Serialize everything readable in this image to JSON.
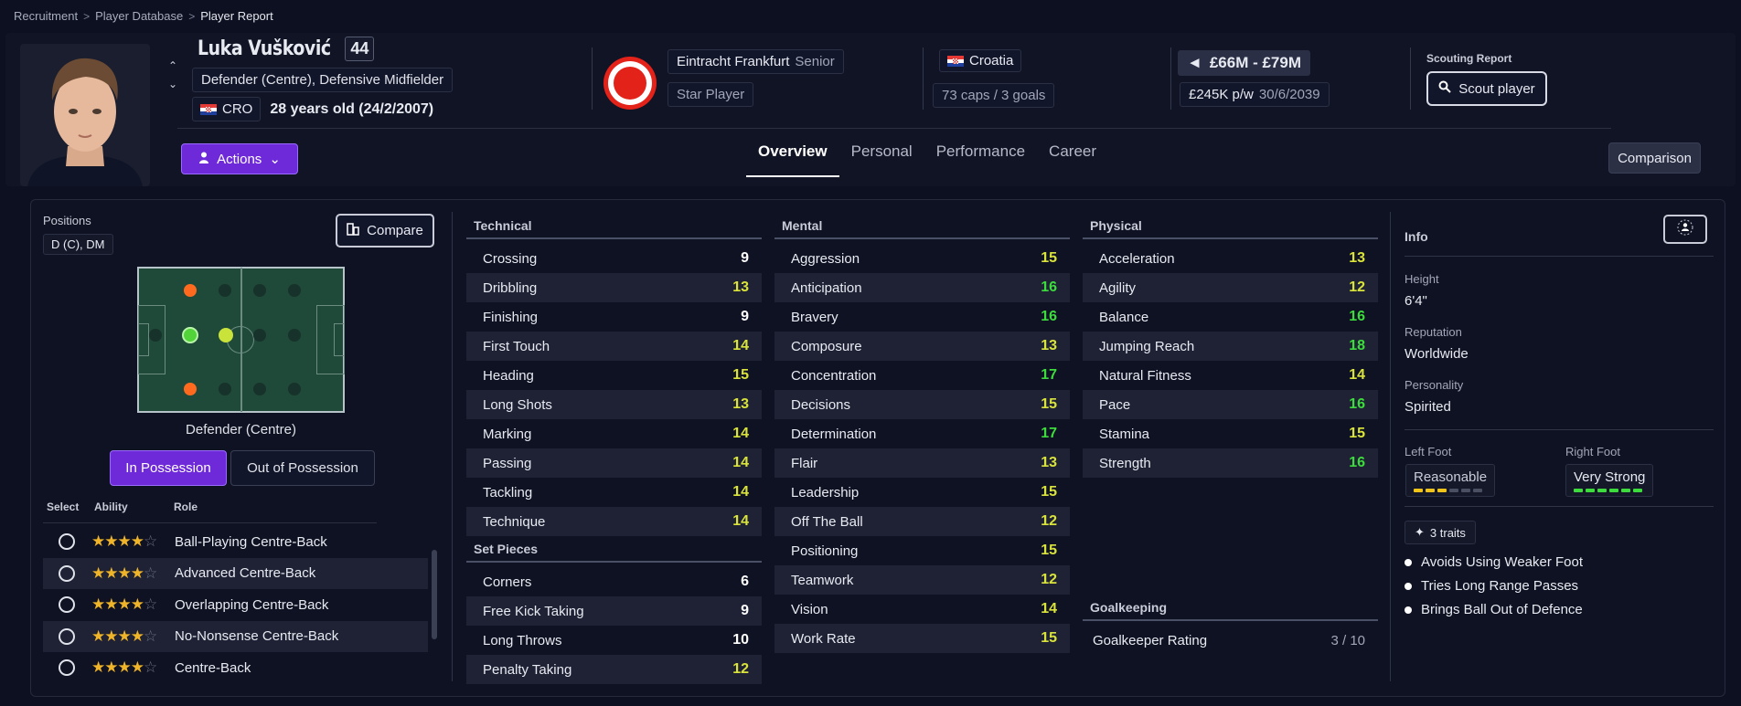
{
  "breadcrumb": [
    "Recruitment",
    "Player Database",
    "Player Report"
  ],
  "player": {
    "name": "Luka Vušković",
    "ca": "44",
    "positions": "Defender (Centre), Defensive Midfielder",
    "nationality_code": "CRO",
    "age": "28 years old (24/2/2007)"
  },
  "club": {
    "name": "Eintracht Frankfurt",
    "squad": "Senior",
    "status": "Star Player"
  },
  "international": {
    "country": "Croatia",
    "caps": "73 caps / 3 goals"
  },
  "value": {
    "range": "£66M - £79M",
    "wage": "£245K p/w",
    "expiry": "30/6/2039"
  },
  "scouting": {
    "label": "Scouting Report",
    "button": "Scout player"
  },
  "actions_label": "Actions",
  "tabs": [
    "Overview",
    "Personal",
    "Performance",
    "Career"
  ],
  "active_tab": "Overview",
  "comparison_label": "Comparison",
  "left": {
    "positions_label": "Positions",
    "positions_value": "D (C), DM",
    "compare_label": "Compare",
    "pitch_label": "Defender (Centre)",
    "possession": [
      "In Possession",
      "Out of Possession"
    ],
    "role_headers": [
      "Select",
      "Ability",
      "Role"
    ],
    "roles": [
      {
        "name": "Ball-Playing Centre-Back",
        "stars": 4
      },
      {
        "name": "Advanced Centre-Back",
        "stars": 4
      },
      {
        "name": "Overlapping Centre-Back",
        "stars": 4
      },
      {
        "name": "No-Nonsense Centre-Back",
        "stars": 4
      },
      {
        "name": "Centre-Back",
        "stars": 4
      }
    ]
  },
  "technical": {
    "title": "Technical",
    "rows": [
      [
        "Crossing",
        "9"
      ],
      [
        "Dribbling",
        "13"
      ],
      [
        "Finishing",
        "9"
      ],
      [
        "First Touch",
        "14"
      ],
      [
        "Heading",
        "15"
      ],
      [
        "Long Shots",
        "13"
      ],
      [
        "Marking",
        "14"
      ],
      [
        "Passing",
        "14"
      ],
      [
        "Tackling",
        "14"
      ],
      [
        "Technique",
        "14"
      ]
    ]
  },
  "set_pieces": {
    "title": "Set Pieces",
    "rows": [
      [
        "Corners",
        "6"
      ],
      [
        "Free Kick Taking",
        "9"
      ],
      [
        "Long Throws",
        "10"
      ],
      [
        "Penalty Taking",
        "12"
      ]
    ]
  },
  "mental": {
    "title": "Mental",
    "rows": [
      [
        "Aggression",
        "15"
      ],
      [
        "Anticipation",
        "16"
      ],
      [
        "Bravery",
        "16"
      ],
      [
        "Composure",
        "13"
      ],
      [
        "Concentration",
        "17"
      ],
      [
        "Decisions",
        "15"
      ],
      [
        "Determination",
        "17"
      ],
      [
        "Flair",
        "13"
      ],
      [
        "Leadership",
        "15"
      ],
      [
        "Off The Ball",
        "12"
      ],
      [
        "Positioning",
        "15"
      ],
      [
        "Teamwork",
        "12"
      ],
      [
        "Vision",
        "14"
      ],
      [
        "Work Rate",
        "15"
      ]
    ]
  },
  "physical": {
    "title": "Physical",
    "rows": [
      [
        "Acceleration",
        "13"
      ],
      [
        "Agility",
        "12"
      ],
      [
        "Balance",
        "16"
      ],
      [
        "Jumping Reach",
        "18"
      ],
      [
        "Natural Fitness",
        "14"
      ],
      [
        "Pace",
        "16"
      ],
      [
        "Stamina",
        "15"
      ],
      [
        "Strength",
        "16"
      ]
    ]
  },
  "goalkeeping": {
    "title": "Goalkeeping",
    "rows": [
      [
        "Goalkeeper Rating",
        "3 / 10"
      ]
    ]
  },
  "info": {
    "title": "Info",
    "height_label": "Height",
    "height": "6'4\"",
    "reputation_label": "Reputation",
    "reputation": "Worldwide",
    "personality_label": "Personality",
    "personality": "Spirited",
    "left_foot_label": "Left Foot",
    "left_foot": "Reasonable",
    "left_foot_level": 3,
    "right_foot_label": "Right Foot",
    "right_foot": "Very Strong",
    "right_foot_level": 6,
    "traits_count": "3 traits",
    "traits": [
      "Avoids Using Weaker Foot",
      "Tries Long Range Passes",
      "Brings Ball Out of Defence"
    ]
  },
  "colors": {
    "accent": "#6e29d8",
    "attr_high": "#3ddc3d",
    "attr_mid": "#d9e33a",
    "attr_low": "#ffffff"
  }
}
